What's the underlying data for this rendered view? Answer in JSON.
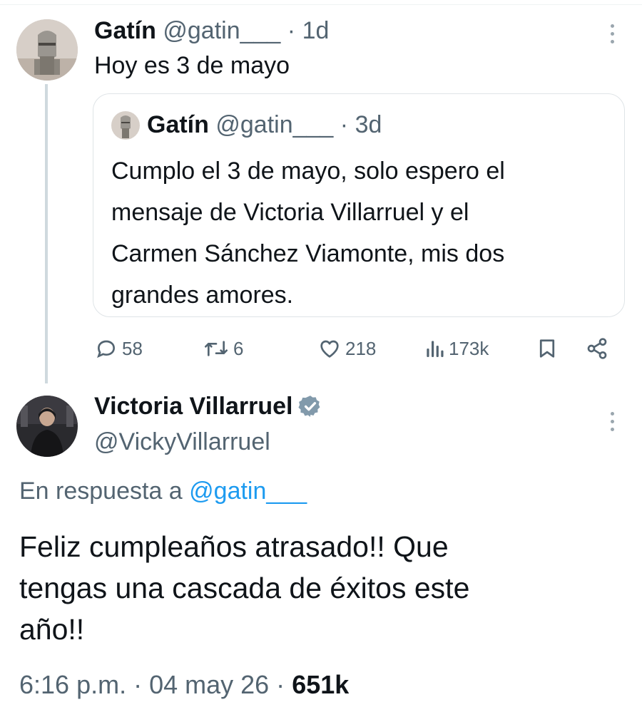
{
  "tweet1": {
    "display_name": "Gatín",
    "handle": "@gatin___",
    "time": "· 1d",
    "text": "Hoy es 3 de mayo"
  },
  "quote": {
    "display_name": "Gatín",
    "handle": "@gatin___",
    "time": "· 3d",
    "lines": [
      "Cumplo el 3 de mayo, solo espero el",
      "mensaje de Victoria Villarruel y el",
      "Carmen Sánchez Viamonte, mis dos",
      "grandes amores."
    ]
  },
  "actions": {
    "replies": "58",
    "retweets": "6",
    "likes": "218",
    "views": "173k",
    "icons": [
      "reply-icon",
      "retweet-icon",
      "like-icon",
      "views-icon",
      "bookmark-icon",
      "share-icon"
    ]
  },
  "reply": {
    "display_name": "Victoria Villarruel",
    "handle": "@VickyVillarruel",
    "verified": true,
    "reply_prefix": "En respuesta a",
    "reply_to": "@gatin___",
    "lines": [
      "Feliz cumpleaños atrasado!! Que",
      "tengas una cascada de éxitos este",
      "año!!"
    ],
    "timestamp": "6:16 p.m. · 04 may 26 ·",
    "views": "651k"
  },
  "colors": {
    "text": "#0f1419",
    "muted": "#536471",
    "link": "#1d9bf0",
    "border": "#dfe4e7",
    "thread_line": "#cfd9de",
    "verified_badge": "#829aab"
  }
}
